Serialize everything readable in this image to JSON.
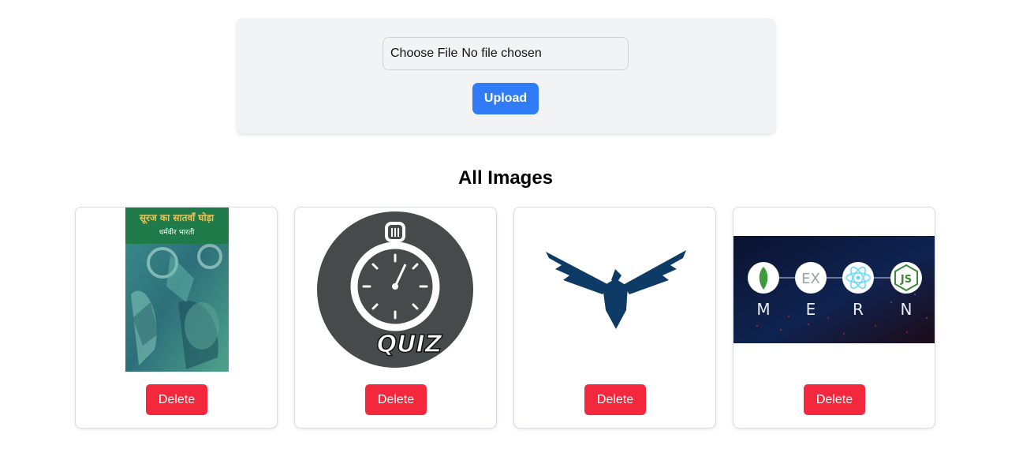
{
  "upload": {
    "file_button_label": "Choose File",
    "file_status": "No file chosen",
    "upload_label": "Upload"
  },
  "gallery": {
    "title": "All Images",
    "cards": [
      {
        "image": "book-cover",
        "title_text": "सूरज का सातवाँ घोड़ा",
        "author_text": "धर्मवीर भारती",
        "delete_label": "Delete"
      },
      {
        "image": "quiz-stopwatch",
        "logo_text": "QUIZ",
        "delete_label": "Delete"
      },
      {
        "image": "eagle-logo",
        "delete_label": "Delete"
      },
      {
        "image": "mern-banner",
        "icons": [
          "mongodb",
          "express",
          "react",
          "nodejs"
        ],
        "letters": [
          "M",
          "E",
          "R",
          "N"
        ],
        "icon_text_express": "EX",
        "icon_text_node": "JS",
        "delete_label": "Delete"
      }
    ]
  },
  "colors": {
    "primary": "#2f7cf6",
    "danger": "#f4283d",
    "panel": "#f2f3f5",
    "eagle": "#0d3b66"
  }
}
